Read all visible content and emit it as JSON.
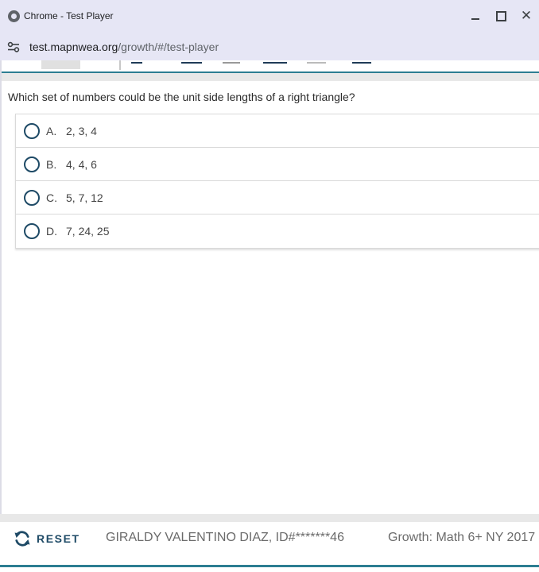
{
  "window": {
    "title": "Chrome - Test Player",
    "minimize_icon": "minimize-icon",
    "maximize_icon": "maximize-icon",
    "close_icon": "close-icon",
    "close_glyph": "✕"
  },
  "address_bar": {
    "url_host": "test.mapnwea.org",
    "url_path": "/growth/#/test-player",
    "site_icon": "tune-icon"
  },
  "question": {
    "prompt": "Which set of numbers could be the unit side lengths of a right triangle?",
    "choices": [
      {
        "letter": "A.",
        "text": "2, 3, 4"
      },
      {
        "letter": "B.",
        "text": "4, 4, 6"
      },
      {
        "letter": "C.",
        "text": "5, 7, 12"
      },
      {
        "letter": "D.",
        "text": "7, 24, 25"
      }
    ]
  },
  "footer": {
    "reset_label": "RESET",
    "student": "GIRALDY VALENTINO DIAZ, ID#*******46",
    "test_name": "Growth: Math 6+ NY 2017"
  },
  "colors": {
    "accent": "#1e4a66",
    "teal": "#2d7e92",
    "chrome_bar": "#e6e6f5"
  }
}
